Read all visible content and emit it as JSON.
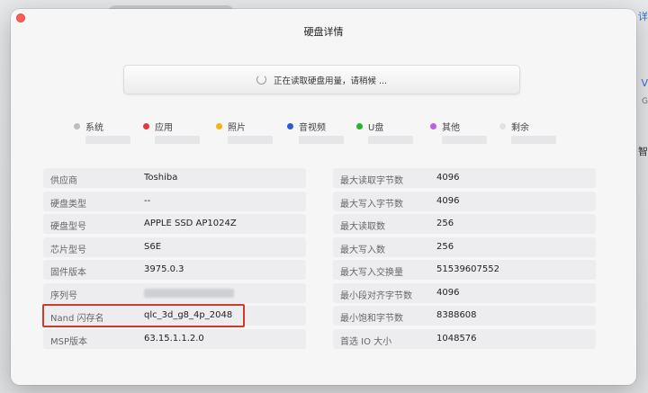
{
  "dialog": {
    "title": "硬盘详情",
    "progress_text": "正在读取硬盘用量，请稍候 ..."
  },
  "background": {
    "edge_texts": [
      "详",
      "V",
      "G",
      "智"
    ]
  },
  "legend": [
    {
      "label": "系统",
      "color": "#bdbdbd"
    },
    {
      "label": "应用",
      "color": "#e23a3a"
    },
    {
      "label": "照片",
      "color": "#f3b41b"
    },
    {
      "label": "音视频",
      "color": "#2a5bd7"
    },
    {
      "label": "U盘",
      "color": "#29b32e"
    },
    {
      "label": "其他",
      "color": "#c05ce8"
    },
    {
      "label": "剩余",
      "color": "#e2e2e2"
    }
  ],
  "info_left": [
    {
      "key": "供应商",
      "value": "Toshiba"
    },
    {
      "key": "硬盘类型",
      "value": "--"
    },
    {
      "key": "硬盘型号",
      "value": "APPLE SSD AP1024Z"
    },
    {
      "key": "芯片型号",
      "value": "S6E"
    },
    {
      "key": "固件版本",
      "value": "3975.0.3"
    },
    {
      "key": "序列号",
      "value": ""
    },
    {
      "key": "Nand 闪存名",
      "value": "qlc_3d_g8_4p_2048"
    },
    {
      "key": "MSP版本",
      "value": "63.15.1.1.2.0"
    }
  ],
  "info_right": [
    {
      "key": "最大读取字节数",
      "value": "4096"
    },
    {
      "key": "最大写入字节数",
      "value": "4096"
    },
    {
      "key": "最大读取数",
      "value": "256"
    },
    {
      "key": "最大写入数",
      "value": "256"
    },
    {
      "key": "最大写入交换量",
      "value": "51539607552"
    },
    {
      "key": "最小段对齐字节数",
      "value": "4096"
    },
    {
      "key": "最小饱和字节数",
      "value": "8388608"
    },
    {
      "key": "首选 IO 大小",
      "value": "1048576"
    }
  ],
  "colors": {
    "highlight": "#d03a2a",
    "close": "#ff5f57"
  }
}
